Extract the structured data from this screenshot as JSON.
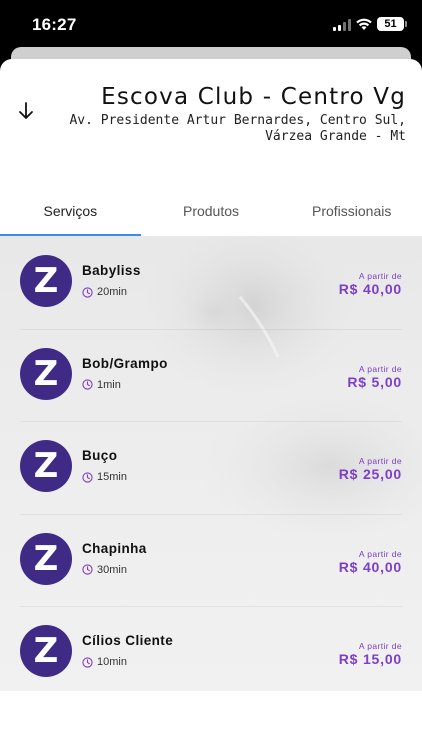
{
  "status_bar": {
    "time": "16:27",
    "battery": "51"
  },
  "store": {
    "name": "Escova Club - Centro Vg",
    "address_line1": "Av. Presidente Artur Bernardes, Centro Sul,",
    "address_line2": "Várzea Grande - Mt"
  },
  "tabs": [
    {
      "label": "Serviços",
      "active": true
    },
    {
      "label": "Produtos",
      "active": false
    },
    {
      "label": "Profissionais",
      "active": false
    }
  ],
  "colors": {
    "accent": "#7d3fc7",
    "logo_bg": "#3f2a86",
    "tab_indicator": "#3c8ce7"
  },
  "services": [
    {
      "name": "Babyliss",
      "duration": "20min",
      "price_caption": "A partir de",
      "price": "R$ 40,00",
      "logo_letter": "Z"
    },
    {
      "name": "Bob/Grampo",
      "duration": "1min",
      "price_caption": "A partir de",
      "price": "R$ 5,00",
      "logo_letter": "Z"
    },
    {
      "name": "Buço",
      "duration": "15min",
      "price_caption": "A partir de",
      "price": "R$ 25,00",
      "logo_letter": "Z"
    },
    {
      "name": "Chapinha",
      "duration": "30min",
      "price_caption": "A partir de",
      "price": "R$ 40,00",
      "logo_letter": "Z"
    },
    {
      "name": "Cílios Cliente",
      "duration": "10min",
      "price_caption": "A partir de",
      "price": "R$ 15,00",
      "logo_letter": "Z"
    }
  ]
}
